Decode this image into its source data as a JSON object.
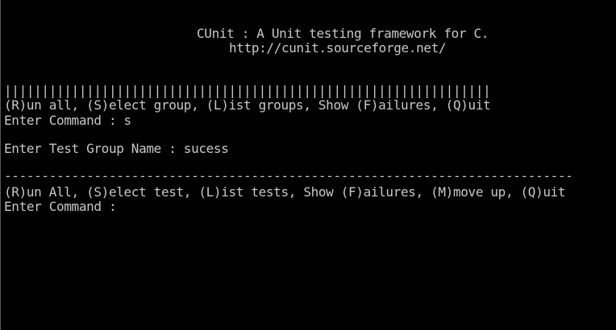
{
  "console": {
    "header_title": "CUnit : A Unit testing framework for C.",
    "header_url": "http://cunit.sourceforge.net/",
    "separator_bars": "|||||||||||||||||||||||||||||||||||||||||||||||||||||||||||||||||",
    "main_menu": "(R)un all, (S)elect group, (L)ist groups, Show (F)ailures, (Q)uit",
    "command_prompt_1": "Enter Command : s",
    "group_prompt": "Enter Test Group Name : sucess",
    "separator_dashes": "----------------------------------------------------------------------------",
    "group_menu": "(R)un All, (S)elect test, (L)ist tests, Show (F)ailures, (M)move up, (Q)uit",
    "command_prompt_2": "Enter Command : "
  },
  "colors": {
    "background": "#000000",
    "text": "#c8c8c8"
  }
}
